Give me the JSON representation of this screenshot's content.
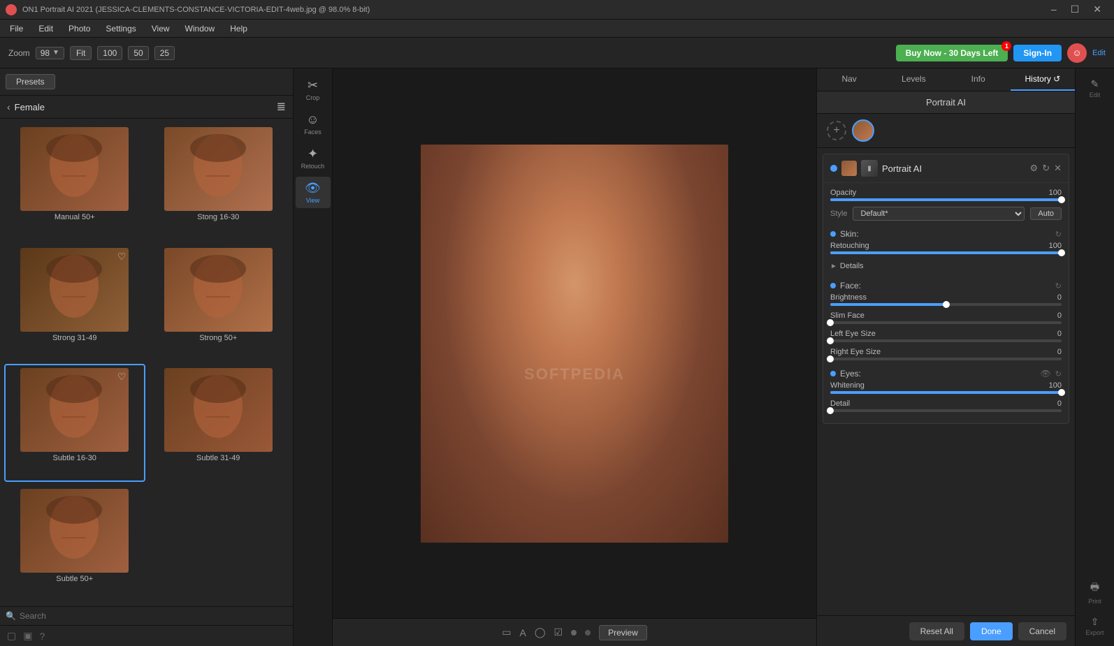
{
  "titlebar": {
    "title": "ON1 Portrait AI 2021 (JESSICA-CLEMENTS-CONSTANCE-VICTORIA-EDIT-4web.jpg @ 98.0% 8-bit)",
    "app_name": "ON1 Portrait AI 2021"
  },
  "menubar": {
    "items": [
      "File",
      "Edit",
      "Photo",
      "Settings",
      "View",
      "Window",
      "Help"
    ]
  },
  "toolbar": {
    "zoom_label": "Zoom",
    "zoom_value": "98",
    "fit_label": "Fit",
    "preset_100": "100",
    "preset_50": "50",
    "preset_25": "25",
    "buy_now": "Buy Now - 30 Days Left",
    "sign_in": "Sign-In",
    "badge_count": "1"
  },
  "tools_sidebar": {
    "items": [
      {
        "id": "crop",
        "label": "Crop",
        "icon": "✂"
      },
      {
        "id": "faces",
        "label": "Faces",
        "icon": "☺"
      },
      {
        "id": "retouch",
        "label": "Retouch",
        "icon": "✦"
      },
      {
        "id": "view",
        "label": "View",
        "icon": "👁"
      }
    ]
  },
  "left_panel": {
    "presets_btn": "Presets",
    "category": "Female",
    "search_placeholder": "Search",
    "presets": [
      {
        "id": "manual-50plus",
        "name": "Manual 50+",
        "selected": false,
        "has_heart": false
      },
      {
        "id": "strong-16-30",
        "name": "Stong 16-30",
        "selected": false,
        "has_heart": false
      },
      {
        "id": "strong-31-49",
        "name": "Strong 31-49",
        "selected": false,
        "has_heart": true
      },
      {
        "id": "strong-50plus",
        "name": "Strong 50+",
        "selected": false,
        "has_heart": false
      },
      {
        "id": "subtle-16-30",
        "name": "Subtle 16-30",
        "selected": true,
        "has_heart": true
      },
      {
        "id": "subtle-31-49",
        "name": "Subtle 31-49",
        "selected": false,
        "has_heart": false
      },
      {
        "id": "subtle-50plus",
        "name": "Subtle 50+",
        "selected": false,
        "has_heart": false
      }
    ]
  },
  "right_panel": {
    "tabs": [
      {
        "id": "nav",
        "label": "Nav",
        "active": false
      },
      {
        "id": "levels",
        "label": "Levels",
        "active": false
      },
      {
        "id": "info",
        "label": "Info",
        "active": false
      },
      {
        "id": "history",
        "label": "History",
        "active": false
      }
    ],
    "portrait_ai_label": "Portrait AI",
    "module": {
      "title": "Portrait AI",
      "opacity_label": "Opacity",
      "opacity_value": "100",
      "style_label": "Style",
      "style_value": "Default*",
      "auto_btn": "Auto",
      "skin_label": "Skin:",
      "retouching_label": "Retouching",
      "retouching_value": "100",
      "retouching_pct": 100,
      "details_label": "Details",
      "face_label": "Face:",
      "brightness_label": "Brightness",
      "brightness_value": "0",
      "brightness_pct": 50,
      "slim_face_label": "Slim Face",
      "slim_face_value": "0",
      "slim_face_pct": 0,
      "left_eye_label": "Left Eye Size",
      "left_eye_value": "0",
      "left_eye_pct": 0,
      "right_eye_label": "Right Eye Size",
      "right_eye_value": "0",
      "right_eye_pct": 0,
      "eyes_label": "Eyes:",
      "whitening_label": "Whitening",
      "whitening_value": "100",
      "whitening_pct": 100,
      "detail_label": "Detail",
      "detail_value": "0",
      "detail_pct": 0
    }
  },
  "bottom_panel": {
    "preview_btn": "Preview",
    "reset_all_btn": "Reset All",
    "done_btn": "Done",
    "cancel_btn": "Cancel"
  },
  "right_sidebar": {
    "items": [
      {
        "id": "edit",
        "label": "Edit",
        "icon": "✏"
      },
      {
        "id": "print",
        "label": "Print",
        "icon": "🖨"
      },
      {
        "id": "export",
        "label": "Export",
        "icon": "↑"
      }
    ]
  },
  "watermark": "SOFTPEDIA"
}
